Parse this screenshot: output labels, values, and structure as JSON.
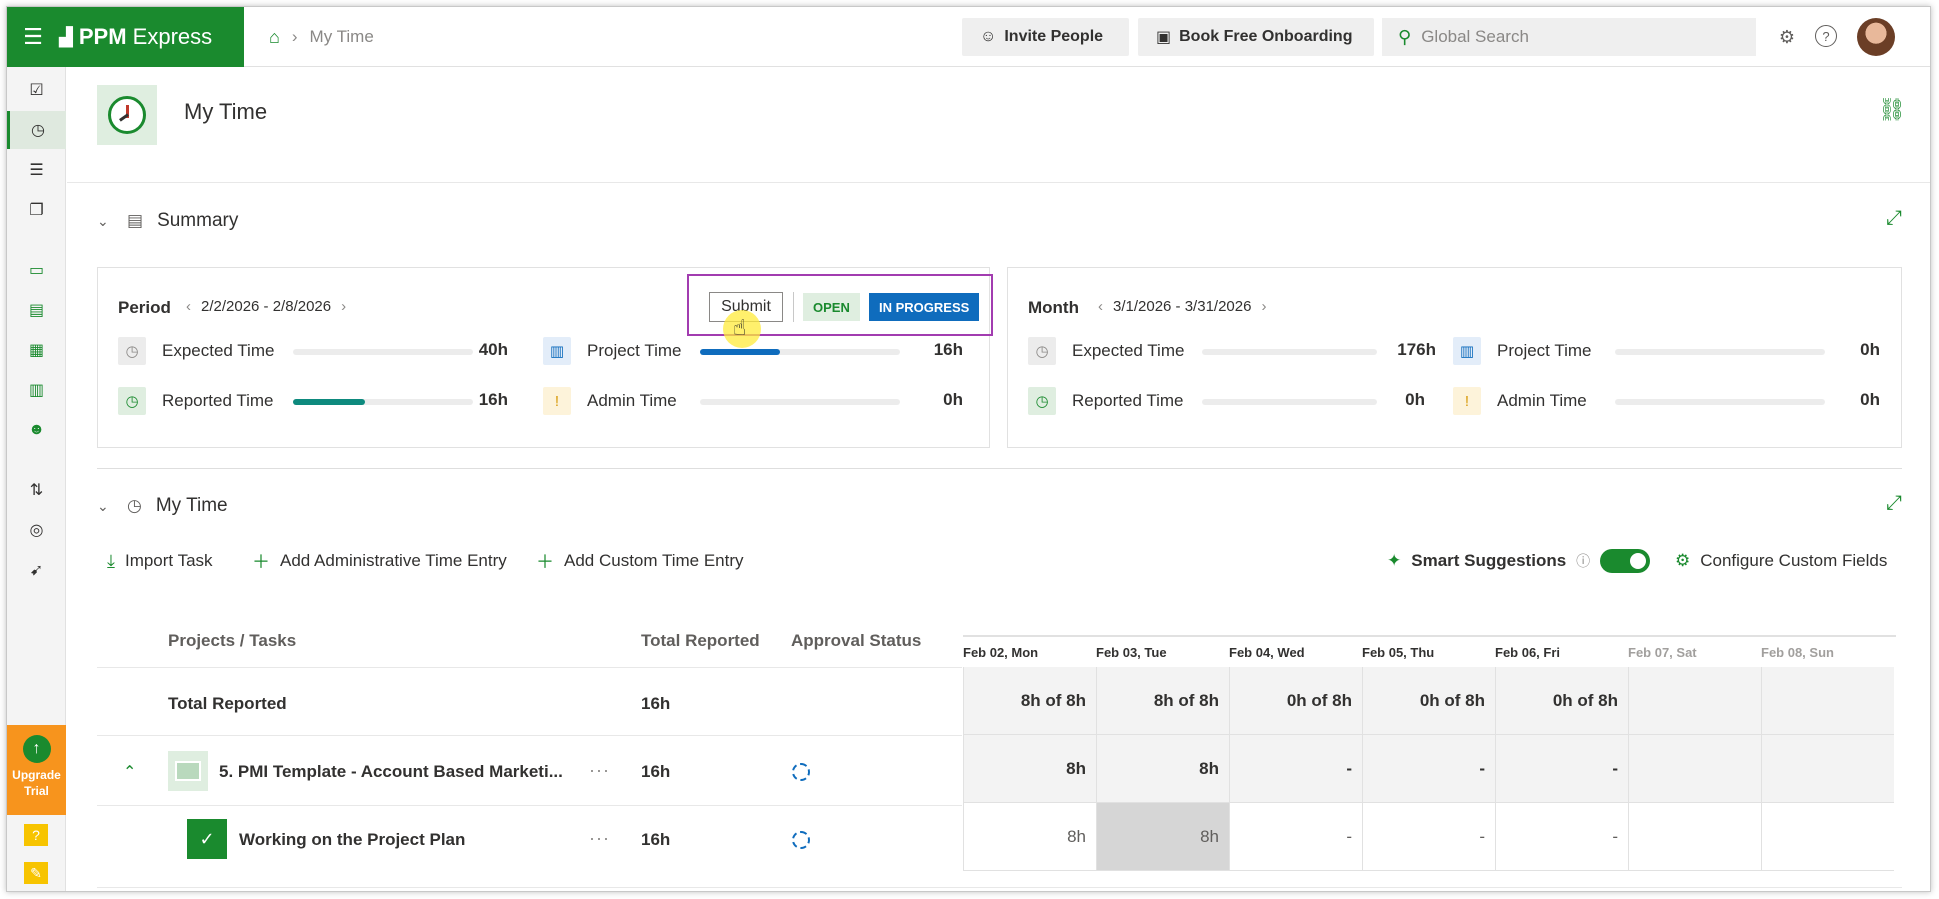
{
  "app": {
    "brand_bold": "PPM",
    "brand_rest": "Express"
  },
  "breadcrumb": {
    "current": "My Time"
  },
  "topbar": {
    "invite_label": "Invite People",
    "onboarding_label": "Book Free Onboarding",
    "search_placeholder": "Global Search"
  },
  "page": {
    "title": "My Time"
  },
  "summary": {
    "title": "Summary",
    "period": {
      "label": "Period",
      "range": "2/2/2026 - 2/8/2026",
      "expected_label": "Expected Time",
      "expected_value": "40h",
      "reported_label": "Reported Time",
      "reported_value": "16h",
      "reported_fraction": 0.4,
      "project_label": "Project Time",
      "project_value": "16h",
      "project_fraction": 0.4,
      "admin_label": "Admin Time",
      "admin_value": "0h",
      "submit_label": "Submit",
      "open_badge": "OPEN",
      "progress_badge": "IN PROGRESS"
    },
    "month": {
      "label": "Month",
      "range": "3/1/2026 - 3/31/2026",
      "expected_label": "Expected Time",
      "expected_value": "176h",
      "reported_label": "Reported Time",
      "reported_value": "0h",
      "project_label": "Project Time",
      "project_value": "0h",
      "admin_label": "Admin Time",
      "admin_value": "0h"
    }
  },
  "mytime": {
    "title": "My Time",
    "import_label": "Import Task",
    "add_admin_label": "Add Administrative Time Entry",
    "add_custom_label": "Add Custom Time Entry",
    "smart_label": "Smart Suggestions",
    "smart_on": true,
    "configure_label": "Configure Custom Fields",
    "columns": {
      "projects": "Projects / Tasks",
      "total": "Total Reported",
      "approval": "Approval Status"
    },
    "days": [
      "Feb 02, Mon",
      "Feb 03, Tue",
      "Feb 04, Wed",
      "Feb 05, Thu",
      "Feb 06, Fri",
      "Feb 07, Sat",
      "Feb 08, Sun"
    ],
    "total_row": {
      "label": "Total Reported",
      "total": "16h",
      "cells": [
        "8h of 8h",
        "8h of 8h",
        "0h of 8h",
        "0h of 8h",
        "0h of 8h",
        "",
        ""
      ]
    },
    "project_row": {
      "label": "5. PMI Template - Account Based Marketi...",
      "total": "16h",
      "cells": [
        "8h",
        "8h",
        "-",
        "-",
        "-",
        "",
        ""
      ]
    },
    "task_row": {
      "label": "Working on the Project Plan",
      "total": "16h",
      "cells": [
        "8h",
        "8h",
        "-",
        "-",
        "-",
        "",
        ""
      ]
    }
  },
  "upgrade": {
    "line1": "Upgrade",
    "line2": "Trial"
  },
  "colors": {
    "brand": "#1a8a2e",
    "accent_blue": "#0f6cbd",
    "highlight": "#a23cb0"
  }
}
